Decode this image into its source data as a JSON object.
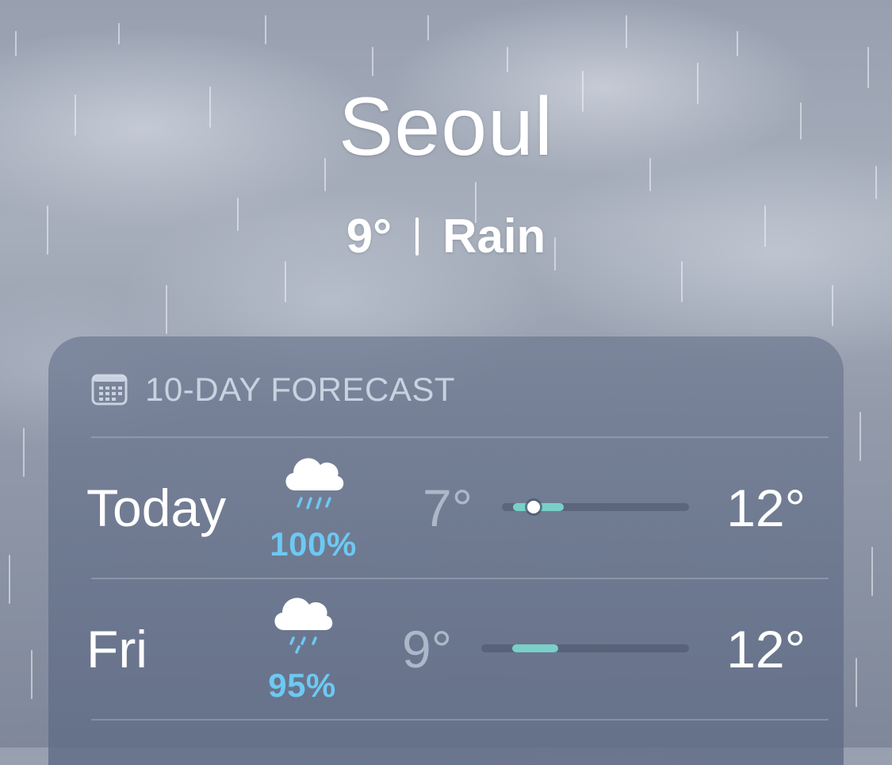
{
  "location": {
    "city": "Seoul",
    "temperature": "9°",
    "condition": "Rain"
  },
  "forecast": {
    "title": "10-DAY FORECAST",
    "icon": "calendar-icon",
    "days": [
      {
        "day": "Today",
        "icon": "cloud-rain-icon",
        "precip": "100%",
        "low": "7°",
        "high": "12°",
        "range_start": 0.06,
        "range_end": 0.33,
        "current_marker": 0.17
      },
      {
        "day": "Fri",
        "icon": "cloud-drizzle-icon",
        "precip": "95%",
        "low": "9°",
        "high": "12°",
        "range_start": 0.15,
        "range_end": 0.37
      }
    ]
  },
  "colors": {
    "precip": "#6cc9f2",
    "range_fill": "#79d0c9"
  }
}
